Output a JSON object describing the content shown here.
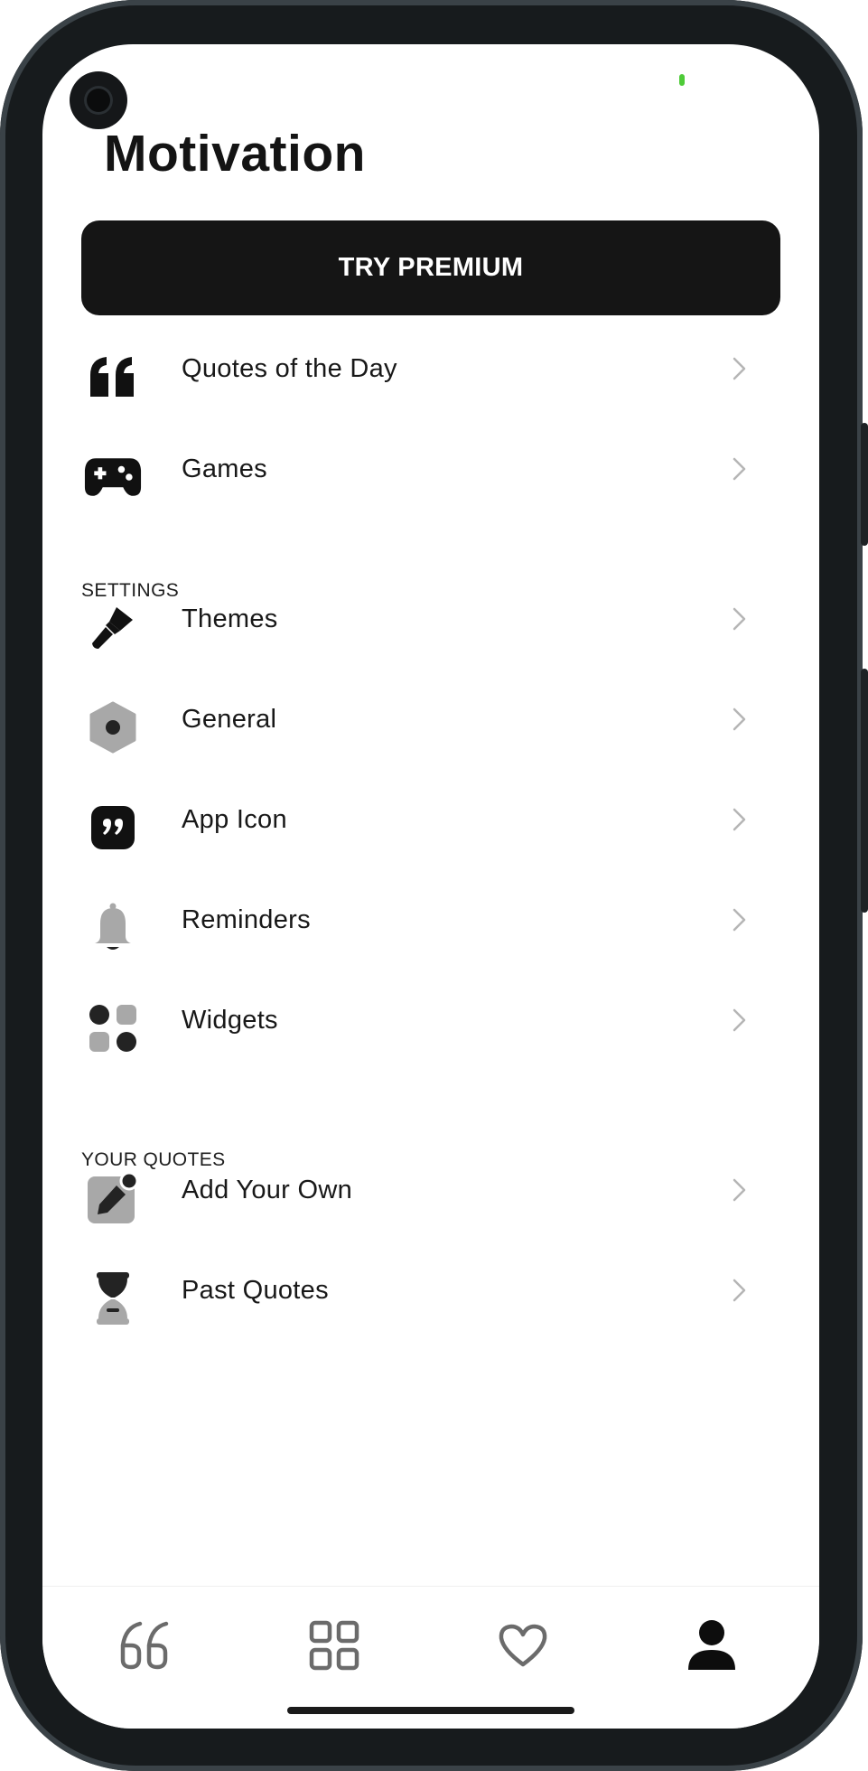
{
  "app": {
    "title": "Motivation"
  },
  "premium_button": {
    "label": "TRY PREMIUM"
  },
  "menu_main": [
    {
      "label": "Quotes of the Day",
      "icon": "quote-icon"
    },
    {
      "label": "Games",
      "icon": "gamepad-icon"
    }
  ],
  "settings": {
    "header": "SETTINGS",
    "items": [
      {
        "label": "Themes",
        "icon": "paintbrush-icon"
      },
      {
        "label": "General",
        "icon": "hexagon-settings-icon"
      },
      {
        "label": "App Icon",
        "icon": "app-quote-icon"
      },
      {
        "label": "Reminders",
        "icon": "bell-icon"
      },
      {
        "label": "Widgets",
        "icon": "widgets-icon"
      }
    ]
  },
  "your_quotes": {
    "header": "YOUR QUOTES",
    "items": [
      {
        "label": "Add Your Own",
        "icon": "edit-note-icon"
      },
      {
        "label": "Past Quotes",
        "icon": "hourglass-icon"
      }
    ]
  },
  "bottom_nav": [
    {
      "icon": "quotes-tab-icon",
      "active": false
    },
    {
      "icon": "categories-grid-icon",
      "active": false
    },
    {
      "icon": "heart-icon",
      "active": false
    },
    {
      "icon": "profile-icon",
      "active": true
    }
  ],
  "colors": {
    "frame": "#171b1d",
    "button_bg": "#151515",
    "icon_gray": "#a8a8a8",
    "icon_dark": "#232323",
    "chevron": "#b5b5b5",
    "status_green": "#4ecb38"
  }
}
